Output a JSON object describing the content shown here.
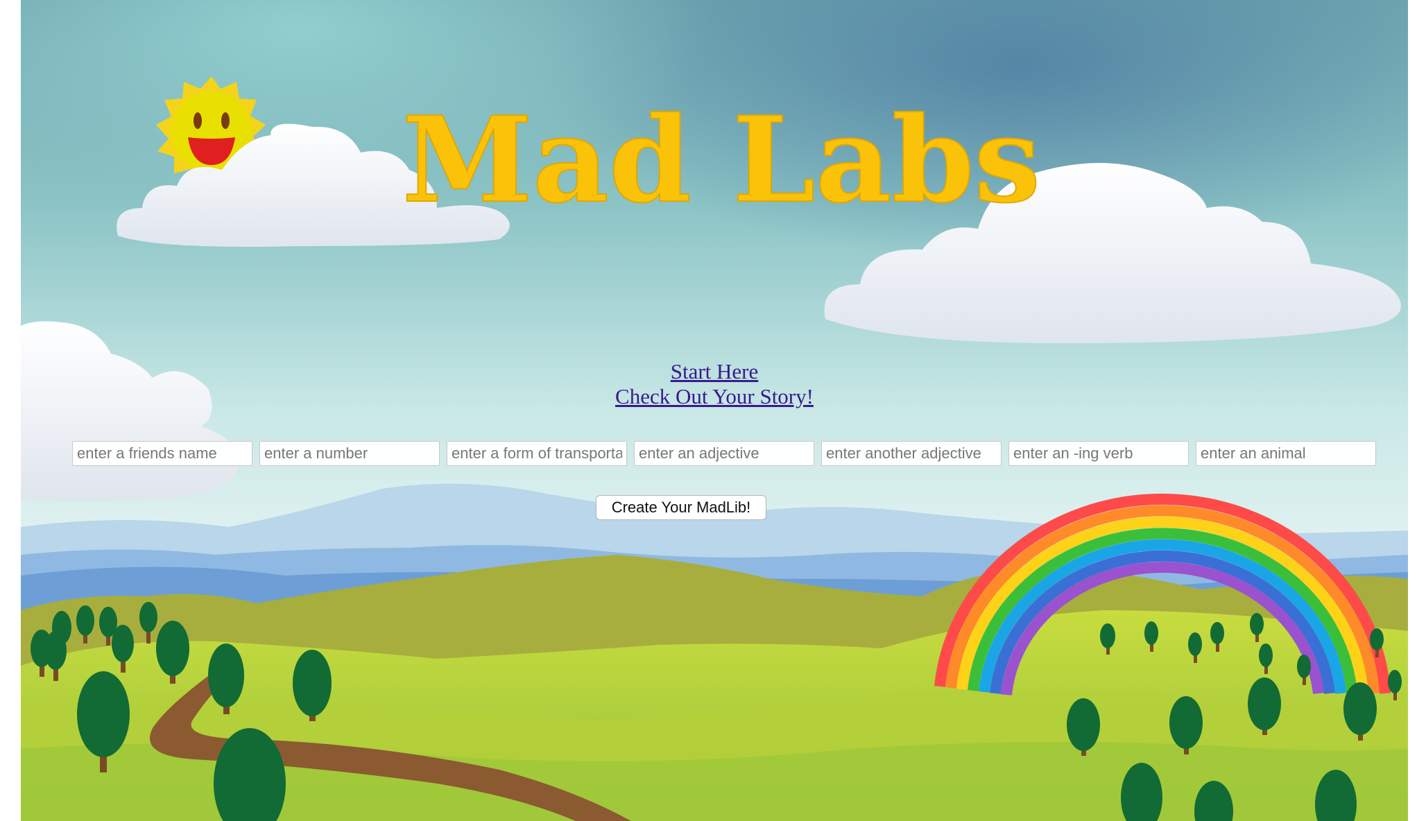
{
  "header": {
    "title": "Mad Labs"
  },
  "nav": {
    "start_here": "Start Here",
    "check_story": "Check Out Your Story!"
  },
  "form": {
    "fields": [
      {
        "placeholder": "enter a friends name",
        "value": ""
      },
      {
        "placeholder": "enter a number",
        "value": ""
      },
      {
        "placeholder": "enter a form of transportation",
        "value": ""
      },
      {
        "placeholder": "enter an adjective",
        "value": ""
      },
      {
        "placeholder": "enter another adjective",
        "value": ""
      },
      {
        "placeholder": "enter an -ing verb",
        "value": ""
      },
      {
        "placeholder": "enter an animal",
        "value": ""
      }
    ],
    "submit_label": "Create Your MadLib!"
  },
  "colors": {
    "title": "#fbc20a",
    "link": "#3a1a8c",
    "sky": "#8cc9cc",
    "grass": "#a8c93a",
    "tree": "#126b34",
    "path": "#8b5a30"
  }
}
